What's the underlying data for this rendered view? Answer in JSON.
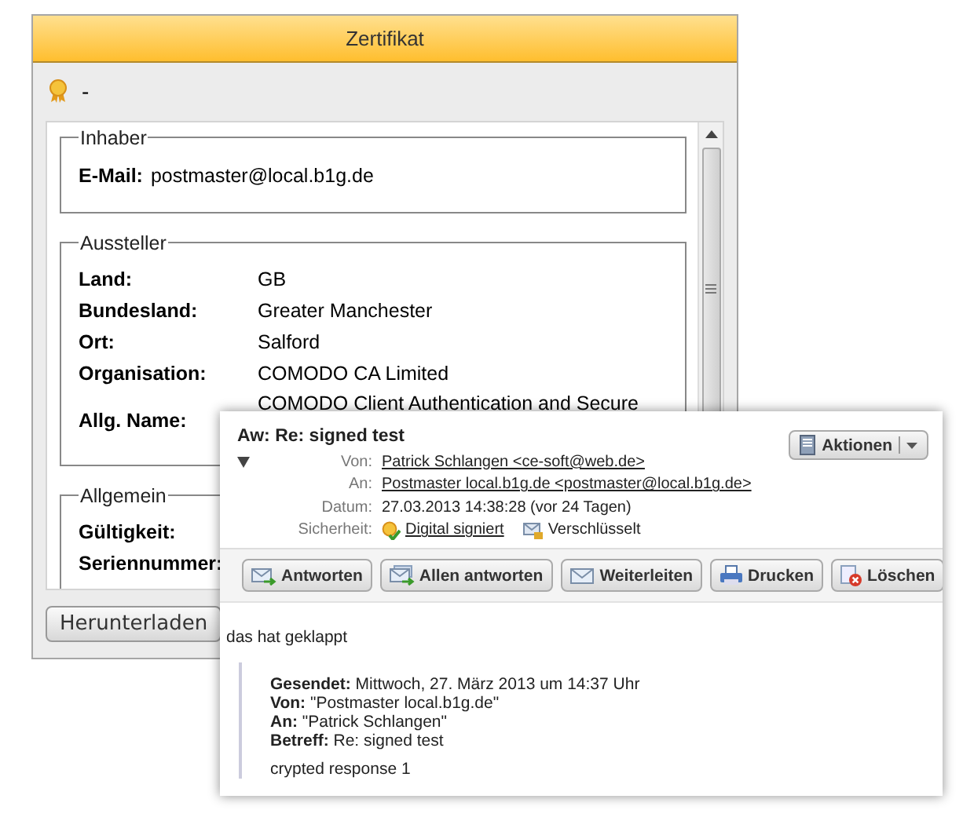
{
  "cert_window": {
    "title": "Zertifikat",
    "cert_name": "-",
    "sections": [
      {
        "legend": "Inhaber",
        "kind": "inline",
        "fields": [
          {
            "label": "E-Mail:",
            "value": "postmaster@local.b1g.de"
          }
        ]
      },
      {
        "legend": "Aussteller",
        "kind": "columns",
        "fields": [
          {
            "label": "Land:",
            "value": "GB"
          },
          {
            "label": "Bundesland:",
            "value": "Greater Manchester"
          },
          {
            "label": "Ort:",
            "value": "Salford"
          },
          {
            "label": "Organisation:",
            "value": "COMODO CA Limited"
          },
          {
            "label": "Allg. Name:",
            "value": "COMODO Client Authentication and Secure"
          }
        ]
      },
      {
        "legend": "Allgemein",
        "kind": "columns",
        "fields": [
          {
            "label": "Gültigkeit:"
          },
          {
            "label": "Seriennummer:"
          }
        ]
      }
    ],
    "download_button": "Herunterladen"
  },
  "message": {
    "subject": "Aw: Re: signed test",
    "actions_button": "Aktionen",
    "headers": [
      {
        "label": "Von:",
        "value": "Patrick Schlangen <ce-soft@web.de>",
        "link": true
      },
      {
        "label": "An:",
        "value": "Postmaster local.b1g.de <postmaster@local.b1g.de>",
        "link": true
      },
      {
        "label": "Datum:",
        "value": "27.03.2013 14:38:28 (vor 24 Tagen)",
        "link": false
      }
    ],
    "security_label": "Sicherheit:",
    "security": [
      {
        "kind": "signed",
        "text": "Digital signiert",
        "link": true
      },
      {
        "kind": "encrypted",
        "text": "Verschlüsselt",
        "link": false
      }
    ],
    "toolbar": [
      {
        "kind": "reply",
        "label": "Antworten"
      },
      {
        "kind": "reply-all",
        "label": "Allen antworten"
      },
      {
        "kind": "forward",
        "label": "Weiterleiten"
      },
      {
        "kind": "print",
        "label": "Drucken"
      },
      {
        "kind": "delete",
        "label": "Löschen"
      }
    ],
    "body_text": "das hat geklappt",
    "quote_headers": [
      {
        "label": "Gesendet:",
        "value": "Mittwoch, 27. März 2013 um 14:37 Uhr"
      },
      {
        "label": "Von:",
        "value": "\"Postmaster local.b1g.de\""
      },
      {
        "label": "An:",
        "value": "\"Patrick Schlangen\""
      },
      {
        "label": "Betreff:",
        "value": "Re: signed test"
      }
    ],
    "quote_text": "crypted response 1"
  }
}
